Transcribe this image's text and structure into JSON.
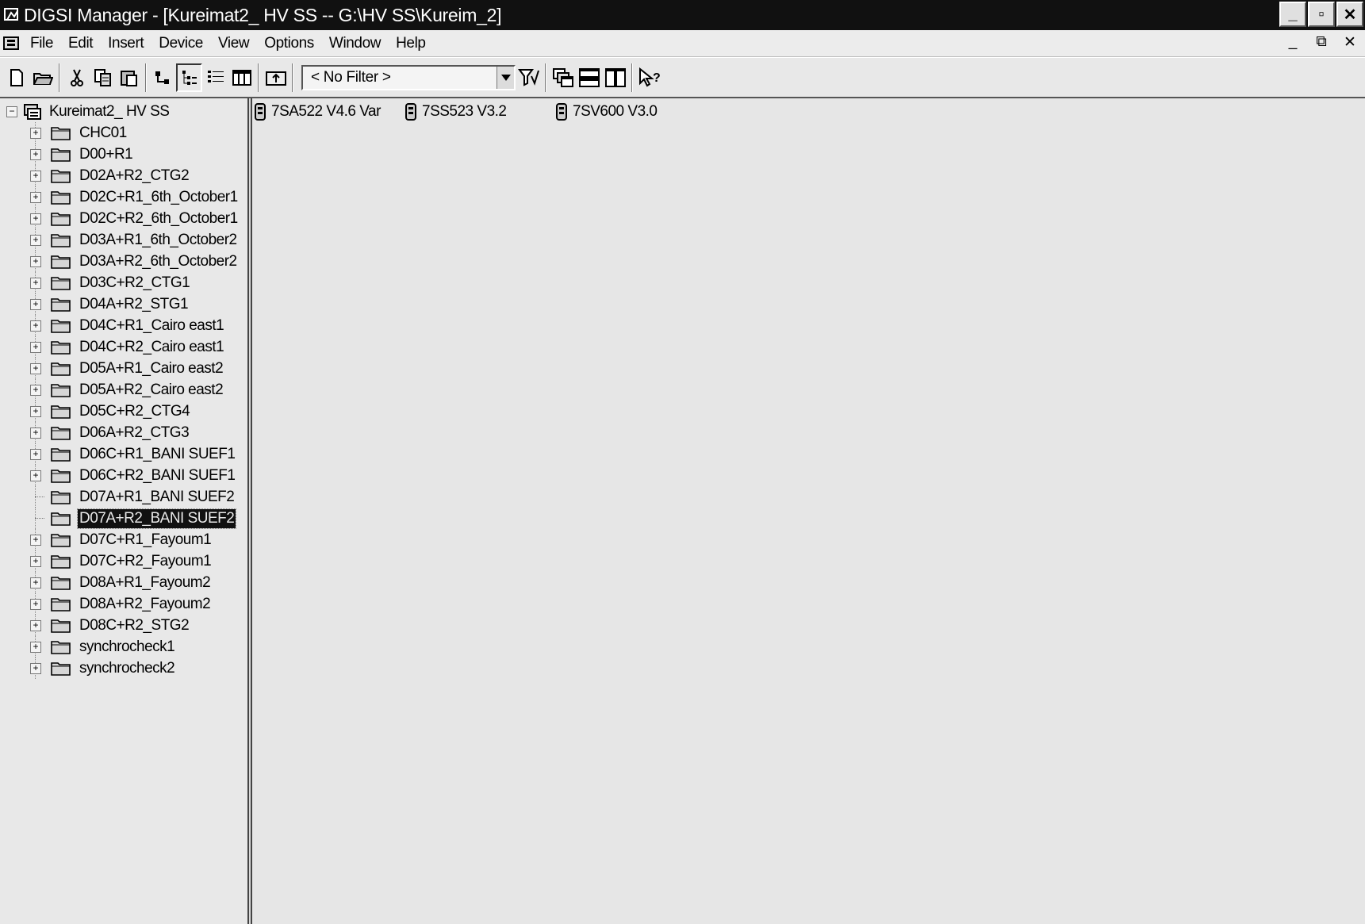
{
  "window": {
    "title": "DIGSI Manager - [Kureimat2_ HV SS -- G:\\HV SS\\Kureim_2]",
    "controls": {
      "minimize": "_",
      "maximize": "▫",
      "close": "✕"
    }
  },
  "menu": {
    "items": [
      "File",
      "Edit",
      "Insert",
      "Device",
      "View",
      "Options",
      "Window",
      "Help"
    ],
    "mdi": {
      "minimize": "_",
      "restore": "⧉",
      "close": "✕"
    }
  },
  "toolbar": {
    "filter": {
      "value": "< No Filter >"
    }
  },
  "tree": {
    "root": "Kureimat2_ HV SS",
    "items": [
      {
        "label": "CHC01",
        "expandable": true
      },
      {
        "label": "D00+R1",
        "expandable": true
      },
      {
        "label": "D02A+R2_CTG2",
        "expandable": true
      },
      {
        "label": "D02C+R1_6th_October1",
        "expandable": true
      },
      {
        "label": "D02C+R2_6th_October1",
        "expandable": true
      },
      {
        "label": "D03A+R1_6th_October2",
        "expandable": true
      },
      {
        "label": "D03A+R2_6th_October2",
        "expandable": true
      },
      {
        "label": "D03C+R2_CTG1",
        "expandable": true
      },
      {
        "label": "D04A+R2_STG1",
        "expandable": true
      },
      {
        "label": "D04C+R1_Cairo east1",
        "expandable": true
      },
      {
        "label": "D04C+R2_Cairo east1",
        "expandable": true
      },
      {
        "label": "D05A+R1_Cairo east2",
        "expandable": true
      },
      {
        "label": "D05A+R2_Cairo east2",
        "expandable": true
      },
      {
        "label": "D05C+R2_CTG4",
        "expandable": true
      },
      {
        "label": "D06A+R2_CTG3",
        "expandable": true
      },
      {
        "label": "D06C+R1_BANI SUEF1",
        "expandable": true
      },
      {
        "label": "D06C+R2_BANI SUEF1",
        "expandable": true
      },
      {
        "label": "D07A+R1_BANI SUEF2",
        "expandable": false
      },
      {
        "label": "D07A+R2_BANI SUEF2",
        "expandable": false,
        "selected": true
      },
      {
        "label": "D07C+R1_Fayoum1",
        "expandable": true
      },
      {
        "label": "D07C+R2_Fayoum1",
        "expandable": true
      },
      {
        "label": "D08A+R1_Fayoum2",
        "expandable": true
      },
      {
        "label": "D08A+R2_Fayoum2",
        "expandable": true
      },
      {
        "label": "D08C+R2_STG2",
        "expandable": true
      },
      {
        "label": "synchrocheck1",
        "expandable": true
      },
      {
        "label": "synchrocheck2",
        "expandable": true
      }
    ]
  },
  "devices": [
    "7SA522 V4.6 Var",
    "7SS523 V3.2",
    "7SV600 V3.0"
  ]
}
